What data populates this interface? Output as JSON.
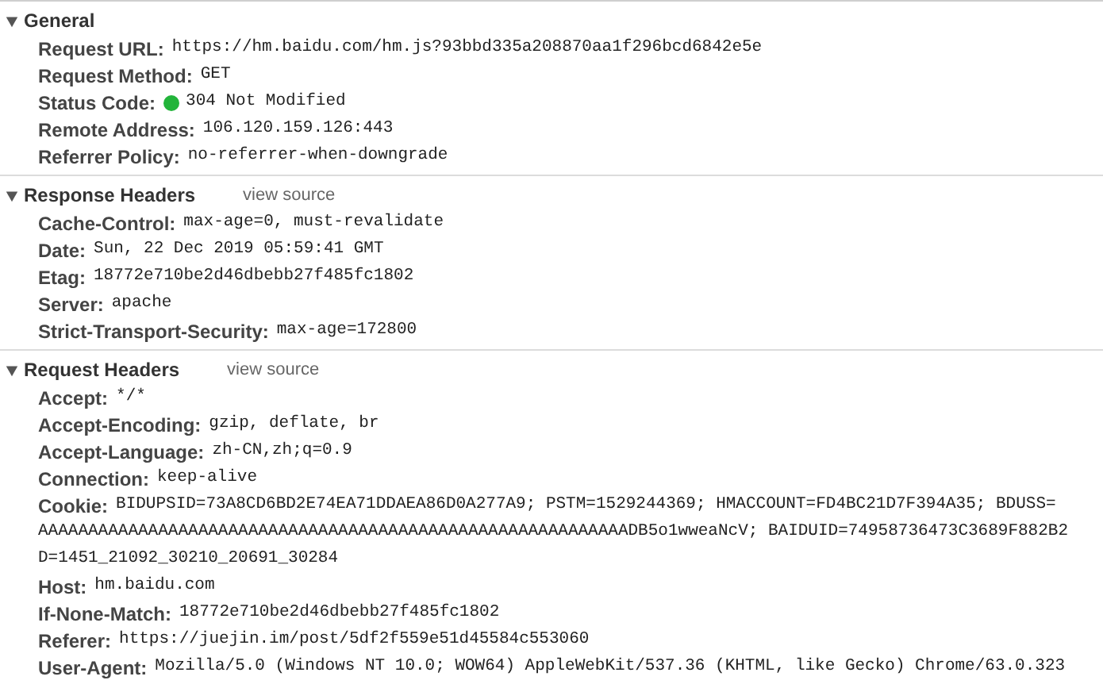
{
  "sections": [
    {
      "title": "General",
      "expanded": true,
      "rows": [
        {
          "name": "Request URL:",
          "value_lines": [
            "https://hm.baidu.com/hm.js?93bbd335a208870aa1f296bcd6842e5e"
          ]
        },
        {
          "name": "Request Method:",
          "value_lines": [
            "GET"
          ]
        },
        {
          "name": "Status Code:",
          "color": "#22b43a",
          "value_lines": [
            "304 Not Modified"
          ]
        },
        {
          "name": "Remote Address:",
          "value_lines": [
            "106.120.159.126:443"
          ]
        },
        {
          "name": "Referrer Policy:",
          "value_lines": [
            "no-referrer-when-downgrade"
          ]
        }
      ]
    },
    {
      "title": "Response Headers",
      "expanded": true,
      "link": "view source",
      "rows": [
        {
          "name": "Cache-Control:",
          "value_lines": [
            "max-age=0, must-revalidate"
          ]
        },
        {
          "name": "Date:",
          "value_lines": [
            "Sun, 22 Dec 2019 05:59:41 GMT"
          ]
        },
        {
          "name": "Etag:",
          "value_lines": [
            "18772e710be2d46dbebb27f485fc1802"
          ]
        },
        {
          "name": "Server:",
          "value_lines": [
            "apache"
          ]
        },
        {
          "name": "Strict-Transport-Security:",
          "value_lines": [
            "max-age=172800"
          ]
        }
      ]
    },
    {
      "title": "Request Headers",
      "expanded": true,
      "link": "view source",
      "rows": [
        {
          "name": "Accept:",
          "value_lines": [
            "*/*"
          ]
        },
        {
          "name": "Accept-Encoding:",
          "value_lines": [
            "gzip, deflate, br"
          ]
        },
        {
          "name": "Accept-Language:",
          "value_lines": [
            "zh-CN,zh;q=0.9"
          ]
        },
        {
          "name": "Connection:",
          "value_lines": [
            "keep-alive"
          ]
        },
        {
          "name": "Cookie:",
          "value_lines": [
            "BIDUPSID=73A8CD6BD2E74EA71DDAEA86D0A277A9; PSTM=1529244369; HMACCOUNT=FD4BC21D7F394A35; BDUSS=",
            "AAAAAAAAAAAAAAAAAAAAAAAAAAAAAAAAAAAAAAAAAAAAAAAAAAAAAAAAAAADB5o1wweaNcV; BAIDUID=74958736473C3689F882B2",
            "D=1451_21092_30210_20691_30284"
          ]
        },
        {
          "name": "Host:",
          "value_lines": [
            "hm.baidu.com"
          ]
        },
        {
          "name": "If-None-Match:",
          "value_lines": [
            "18772e710be2d46dbebb27f485fc1802"
          ]
        },
        {
          "name": "Referer:",
          "value_lines": [
            "https://juejin.im/post/5df2f559e51d45584c553060"
          ]
        },
        {
          "name": "User-Agent:",
          "value_lines": [
            "Mozilla/5.0 (Windows NT 10.0; WOW64) AppleWebKit/537.36 (KHTML, like Gecko) Chrome/63.0.323"
          ]
        }
      ]
    }
  ]
}
